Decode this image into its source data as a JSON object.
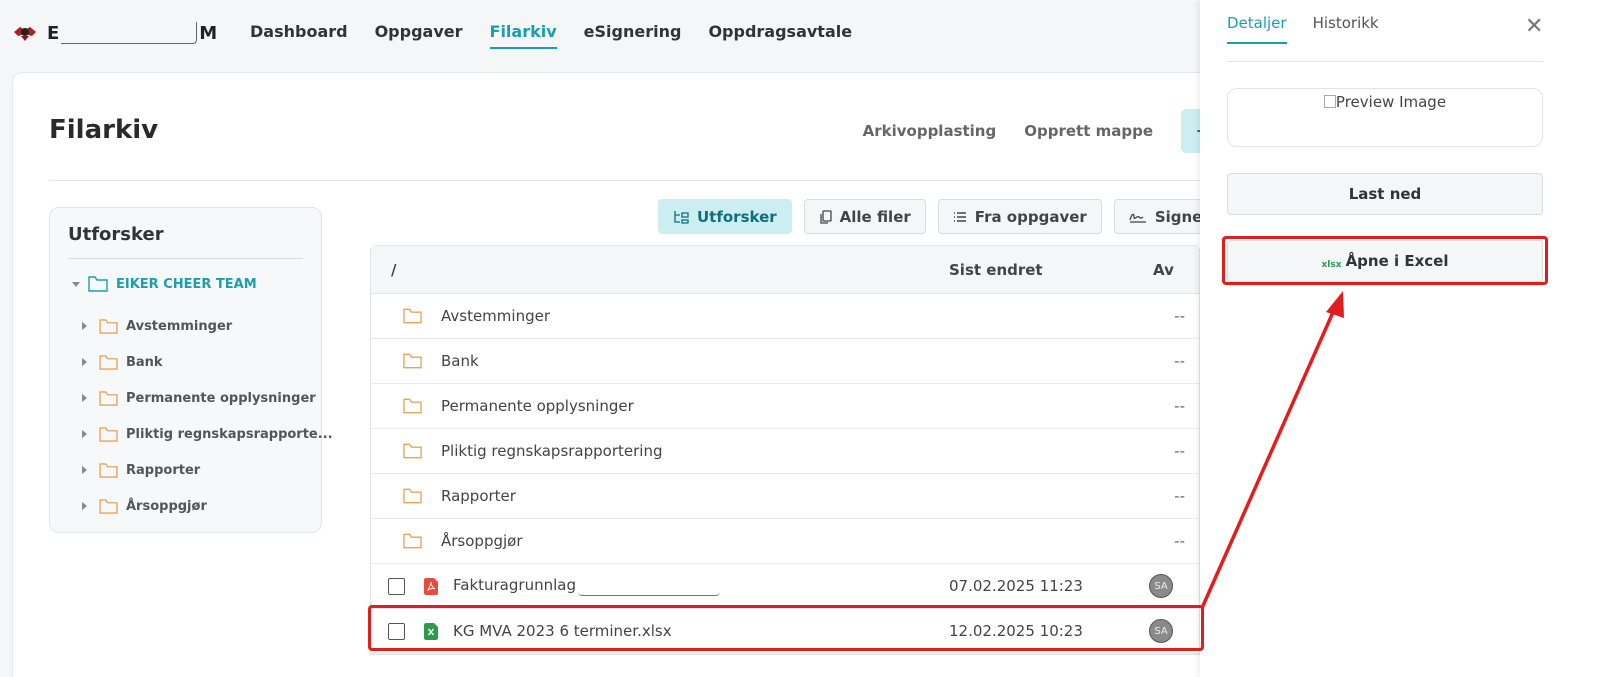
{
  "brand": {
    "first": "E",
    "last": "M"
  },
  "nav": [
    "Dashboard",
    "Oppgaver",
    "Filarkiv",
    "eSignering",
    "Oppdragsavtale"
  ],
  "page": {
    "title": "Filarkiv",
    "actions": [
      "Arkivopplasting",
      "Opprett mappe"
    ],
    "new_symbol": "+"
  },
  "explorer": {
    "title": "Utforsker",
    "root": "EIKER CHEER TEAM",
    "items": [
      "Avstemminger",
      "Bank",
      "Permanente opplysninger",
      "Pliktig regnskapsrapporte...",
      "Rapporter",
      "Årsoppgjør"
    ]
  },
  "tabs": [
    "Utforsker",
    "Alle filer",
    "Fra oppgaver",
    "Signerte doku"
  ],
  "table": {
    "headers": {
      "name": "/",
      "modified": "Sist endret",
      "by": "Av"
    },
    "folders": [
      {
        "name": "Avstemminger",
        "by": "--"
      },
      {
        "name": "Bank",
        "by": "--"
      },
      {
        "name": "Permanente opplysninger",
        "by": "--"
      },
      {
        "name": "Pliktig regnskapsrapportering",
        "by": "--"
      },
      {
        "name": "Rapporter",
        "by": "--"
      },
      {
        "name": "Årsoppgjør",
        "by": "--"
      }
    ],
    "files": [
      {
        "name": "Fakturagrunnlag",
        "modified": "07.02.2025 11:23",
        "by": "SA"
      },
      {
        "name": "KG MVA 2023 6 terminer.xlsx",
        "modified": "12.02.2025 10:23",
        "by": "SA"
      }
    ]
  },
  "panel": {
    "tabs": [
      "Detaljer",
      "Historikk"
    ],
    "close": "✕",
    "preview_alt": "Preview Image",
    "download": "Last ned",
    "open_excel": "Åpne i Excel",
    "xlsx_tag": "xlsx"
  },
  "colors": {
    "accent": "#1a9fb0",
    "highlight": "#e01e1e",
    "folder": "#e8a25a",
    "pdf": "#e84b3c",
    "xlsx": "#2e9a4c"
  }
}
